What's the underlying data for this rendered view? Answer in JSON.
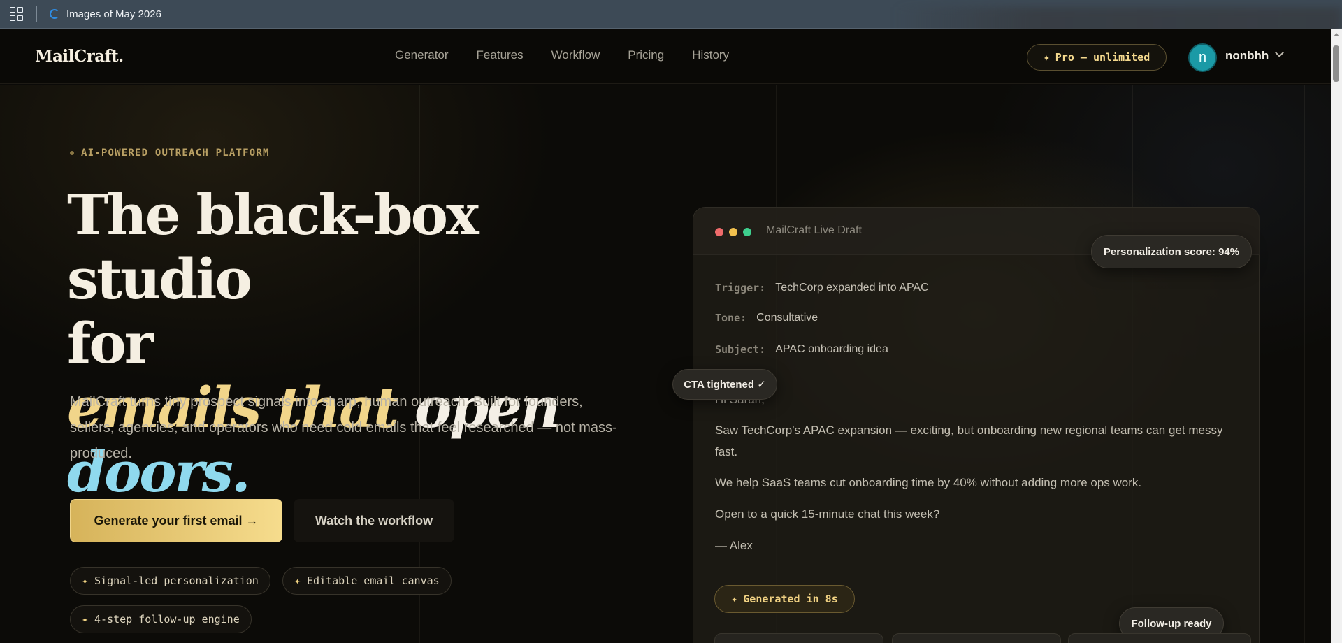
{
  "browser": {
    "bookmark_label": "Images of May 2026"
  },
  "header": {
    "logo": "MailCraft.",
    "nav": [
      "Generator",
      "Features",
      "Workflow",
      "Pricing",
      "History"
    ],
    "pro_badge": "Pro — unlimited",
    "avatar_initial": "n",
    "username": "nonbhh"
  },
  "hero": {
    "eyebrow": "AI-POWERED OUTREACH PLATFORM",
    "headline_line1": "The black-box studio",
    "headline_line2": "for",
    "headline_part_gold": "emails that",
    "headline_part_cream": "open",
    "headline_part_cyan": "doors.",
    "lede": "MailCraft turns tiny prospect signals into sharp, human outreach. Built for founders, sellers, agencies, and operators who need cold emails that feel researched — not mass-produced.",
    "cta_primary": "Generate your first email →",
    "cta_secondary": "Watch the workflow",
    "chips": [
      "Signal-led personalization",
      "Editable email canvas",
      "4-step follow-up engine"
    ]
  },
  "draft": {
    "title": "MailCraft Live Draft",
    "personalization_badge": "Personalization score: 94%",
    "fields": [
      {
        "key": "Trigger:",
        "value": "TechCorp expanded into APAC"
      },
      {
        "key": "Tone:",
        "value": "Consultative"
      },
      {
        "key": "Subject:",
        "value": "APAC onboarding idea"
      }
    ],
    "cta_badge": "CTA tightened ✓",
    "greeting": "Hi Sarah,",
    "paragraph1": "Saw TechCorp's APAC expansion — exciting, but onboarding new regional teams can get messy fast.",
    "paragraph2": "We help SaaS teams cut onboarding time by 40% without adding more ops work.",
    "paragraph3": "Open to a quick 15-minute chat this week?",
    "signature": "— Alex",
    "generated_badge": "Generated in 8s",
    "followup_badge": "Follow-up ready"
  },
  "colors": {
    "accent_gold": "#f1d58a",
    "accent_cyan": "#8fd9ee",
    "avatar_teal": "#1b9aa6",
    "dot_red": "#ef6b6b",
    "dot_yellow": "#f2c14e",
    "dot_green": "#3ecf8e"
  },
  "icons": [
    "apps-grid-icon",
    "bookmark-icon",
    "chevron-down-icon",
    "sparkle-icon"
  ]
}
